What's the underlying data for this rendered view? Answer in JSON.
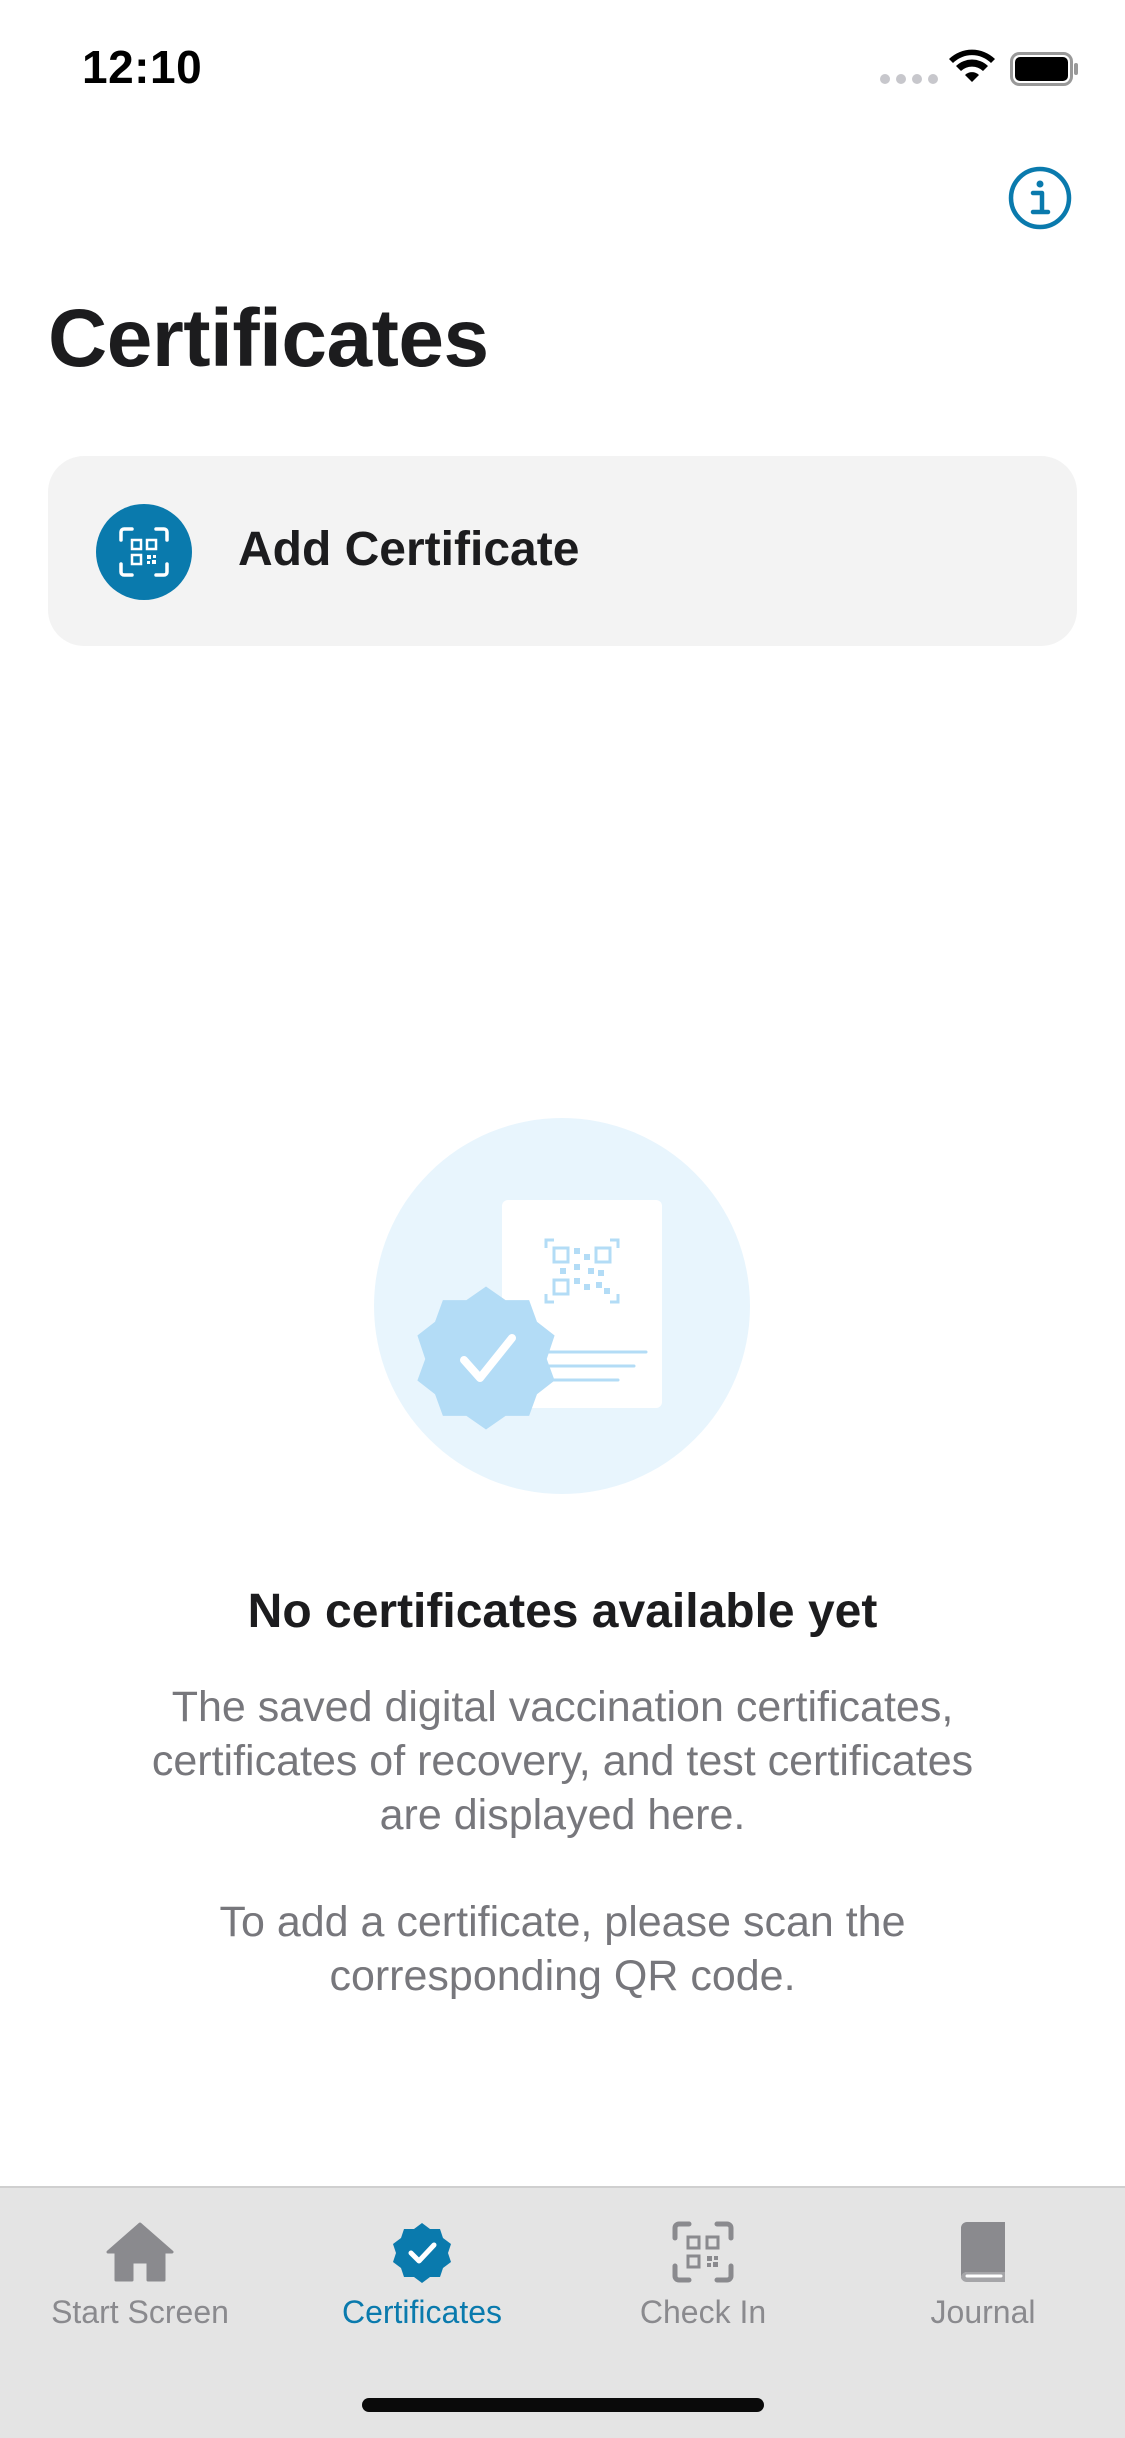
{
  "status_bar": {
    "time": "12:10"
  },
  "header": {
    "title": "Certificates",
    "info_icon": "info-icon"
  },
  "add_certificate": {
    "label": "Add Certificate",
    "icon": "qr-scan-icon"
  },
  "empty_state": {
    "title": "No certificates available yet",
    "description": "The saved digital vaccination certificates, certificates of recovery, and test certificates are displayed here.",
    "hint": "To add a certificate, please scan the corresponding QR code."
  },
  "tab_bar": {
    "tabs": [
      {
        "label": "Start Screen",
        "icon": "home-icon",
        "active": false
      },
      {
        "label": "Certificates",
        "icon": "certificate-badge-icon",
        "active": true
      },
      {
        "label": "Check In",
        "icon": "qr-scan-icon",
        "active": false
      },
      {
        "label": "Journal",
        "icon": "book-icon",
        "active": false
      }
    ]
  },
  "colors": {
    "accent": "#0a7aad",
    "illustration_bg": "#e8f5fd",
    "illustration_badge": "#b3dcf6",
    "secondary_text": "#77777c",
    "inactive_tab": "#8a8a8e"
  }
}
